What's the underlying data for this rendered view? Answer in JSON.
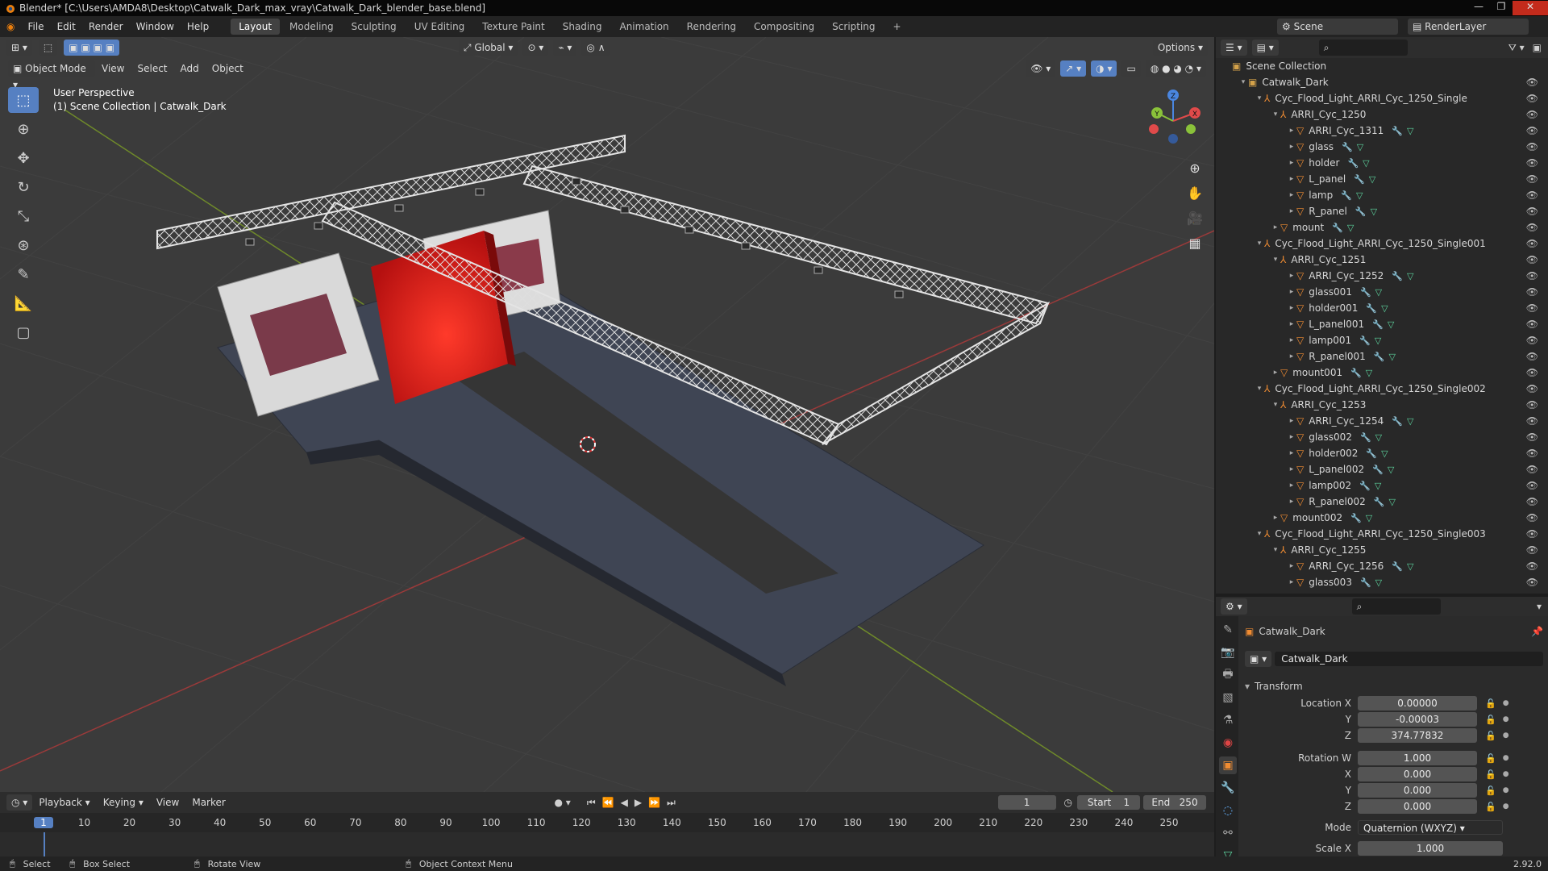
{
  "window": {
    "title": "Blender* [C:\\Users\\AMDA8\\Desktop\\Catwalk_Dark_max_vray\\Catwalk_Dark_blender_base.blend]"
  },
  "menus": [
    "File",
    "Edit",
    "Render",
    "Window",
    "Help"
  ],
  "workspaces": [
    "Layout",
    "Modeling",
    "Sculpting",
    "UV Editing",
    "Texture Paint",
    "Shading",
    "Animation",
    "Rendering",
    "Compositing",
    "Scripting",
    "+"
  ],
  "scene": {
    "label": "Scene",
    "render_layer": "RenderLayer"
  },
  "viewport": {
    "mode": "Object Mode",
    "menus": [
      "View",
      "Select",
      "Add",
      "Object"
    ],
    "transform_orientation": "Global",
    "options": "Options",
    "overlay_title": "User Perspective",
    "overlay_sub": "(1) Scene Collection | Catwalk_Dark",
    "axes": {
      "x": "X",
      "y": "Y",
      "z": "Z"
    }
  },
  "outliner": {
    "root": "Scene Collection",
    "rows": [
      {
        "depth": 0,
        "arrow": "▾",
        "icon": "collection",
        "label": "Catwalk_Dark",
        "mods": false
      },
      {
        "depth": 1,
        "arrow": "▾",
        "icon": "empty",
        "label": "Cyc_Flood_Light_ARRI_Cyc_1250_Single",
        "mods": false
      },
      {
        "depth": 2,
        "arrow": "▾",
        "icon": "empty",
        "label": "ARRI_Cyc_1250",
        "mods": false
      },
      {
        "depth": 3,
        "arrow": "▸",
        "icon": "mesh",
        "label": "ARRI_Cyc_1311",
        "mods": true
      },
      {
        "depth": 3,
        "arrow": "▸",
        "icon": "mesh",
        "label": "glass",
        "mods": true
      },
      {
        "depth": 3,
        "arrow": "▸",
        "icon": "mesh",
        "label": "holder",
        "mods": true
      },
      {
        "depth": 3,
        "arrow": "▸",
        "icon": "mesh",
        "label": "L_panel",
        "mods": true
      },
      {
        "depth": 3,
        "arrow": "▸",
        "icon": "mesh",
        "label": "lamp",
        "mods": true
      },
      {
        "depth": 3,
        "arrow": "▸",
        "icon": "mesh",
        "label": "R_panel",
        "mods": true
      },
      {
        "depth": 2,
        "arrow": "▸",
        "icon": "mesh",
        "label": "mount",
        "mods": true
      },
      {
        "depth": 1,
        "arrow": "▾",
        "icon": "empty",
        "label": "Cyc_Flood_Light_ARRI_Cyc_1250_Single001",
        "mods": false
      },
      {
        "depth": 2,
        "arrow": "▾",
        "icon": "empty",
        "label": "ARRI_Cyc_1251",
        "mods": false
      },
      {
        "depth": 3,
        "arrow": "▸",
        "icon": "mesh",
        "label": "ARRI_Cyc_1252",
        "mods": true
      },
      {
        "depth": 3,
        "arrow": "▸",
        "icon": "mesh",
        "label": "glass001",
        "mods": true
      },
      {
        "depth": 3,
        "arrow": "▸",
        "icon": "mesh",
        "label": "holder001",
        "mods": true
      },
      {
        "depth": 3,
        "arrow": "▸",
        "icon": "mesh",
        "label": "L_panel001",
        "mods": true
      },
      {
        "depth": 3,
        "arrow": "▸",
        "icon": "mesh",
        "label": "lamp001",
        "mods": true
      },
      {
        "depth": 3,
        "arrow": "▸",
        "icon": "mesh",
        "label": "R_panel001",
        "mods": true
      },
      {
        "depth": 2,
        "arrow": "▸",
        "icon": "mesh",
        "label": "mount001",
        "mods": true
      },
      {
        "depth": 1,
        "arrow": "▾",
        "icon": "empty",
        "label": "Cyc_Flood_Light_ARRI_Cyc_1250_Single002",
        "mods": false
      },
      {
        "depth": 2,
        "arrow": "▾",
        "icon": "empty",
        "label": "ARRI_Cyc_1253",
        "mods": false
      },
      {
        "depth": 3,
        "arrow": "▸",
        "icon": "mesh",
        "label": "ARRI_Cyc_1254",
        "mods": true
      },
      {
        "depth": 3,
        "arrow": "▸",
        "icon": "mesh",
        "label": "glass002",
        "mods": true
      },
      {
        "depth": 3,
        "arrow": "▸",
        "icon": "mesh",
        "label": "holder002",
        "mods": true
      },
      {
        "depth": 3,
        "arrow": "▸",
        "icon": "mesh",
        "label": "L_panel002",
        "mods": true
      },
      {
        "depth": 3,
        "arrow": "▸",
        "icon": "mesh",
        "label": "lamp002",
        "mods": true
      },
      {
        "depth": 3,
        "arrow": "▸",
        "icon": "mesh",
        "label": "R_panel002",
        "mods": true
      },
      {
        "depth": 2,
        "arrow": "▸",
        "icon": "mesh",
        "label": "mount002",
        "mods": true
      },
      {
        "depth": 1,
        "arrow": "▾",
        "icon": "empty",
        "label": "Cyc_Flood_Light_ARRI_Cyc_1250_Single003",
        "mods": false
      },
      {
        "depth": 2,
        "arrow": "▾",
        "icon": "empty",
        "label": "ARRI_Cyc_1255",
        "mods": false
      },
      {
        "depth": 3,
        "arrow": "▸",
        "icon": "mesh",
        "label": "ARRI_Cyc_1256",
        "mods": true
      },
      {
        "depth": 3,
        "arrow": "▸",
        "icon": "mesh",
        "label": "glass003",
        "mods": true
      }
    ]
  },
  "properties": {
    "object_name": "Catwalk_Dark",
    "data_name": "Catwalk_Dark",
    "section": "Transform",
    "fields": [
      {
        "label": "Location X",
        "value": "0.00000"
      },
      {
        "label": "Y",
        "value": "-0.00003"
      },
      {
        "label": "Z",
        "value": "374.77832"
      },
      {
        "label": "Rotation W",
        "value": "1.000"
      },
      {
        "label": "X",
        "value": "0.000"
      },
      {
        "label": "Y",
        "value": "0.000"
      },
      {
        "label": "Z",
        "value": "0.000"
      }
    ],
    "mode_label": "Mode",
    "mode_value": "Quaternion (WXYZ)",
    "scale_label": "Scale X",
    "scale_value": "1.000"
  },
  "timeline": {
    "menus": [
      "Playback",
      "Keying",
      "View",
      "Marker"
    ],
    "current_frame": "1",
    "start_label": "Start",
    "start": "1",
    "end_label": "End",
    "end": "250",
    "ticks": [
      "1",
      "10",
      "20",
      "30",
      "40",
      "50",
      "60",
      "70",
      "80",
      "90",
      "100",
      "110",
      "120",
      "130",
      "140",
      "150",
      "160",
      "170",
      "180",
      "190",
      "200",
      "210",
      "220",
      "230",
      "240",
      "250"
    ]
  },
  "status": {
    "select": "Select",
    "box_select": "Box Select",
    "rotate": "Rotate View",
    "context": "Object Context Menu",
    "version": "2.92.0"
  },
  "colors": {
    "accent": "#5680c2",
    "viewport_bg": "#3b3b3b",
    "red_panel": "#d41a1a",
    "stage": "#3f4554"
  }
}
